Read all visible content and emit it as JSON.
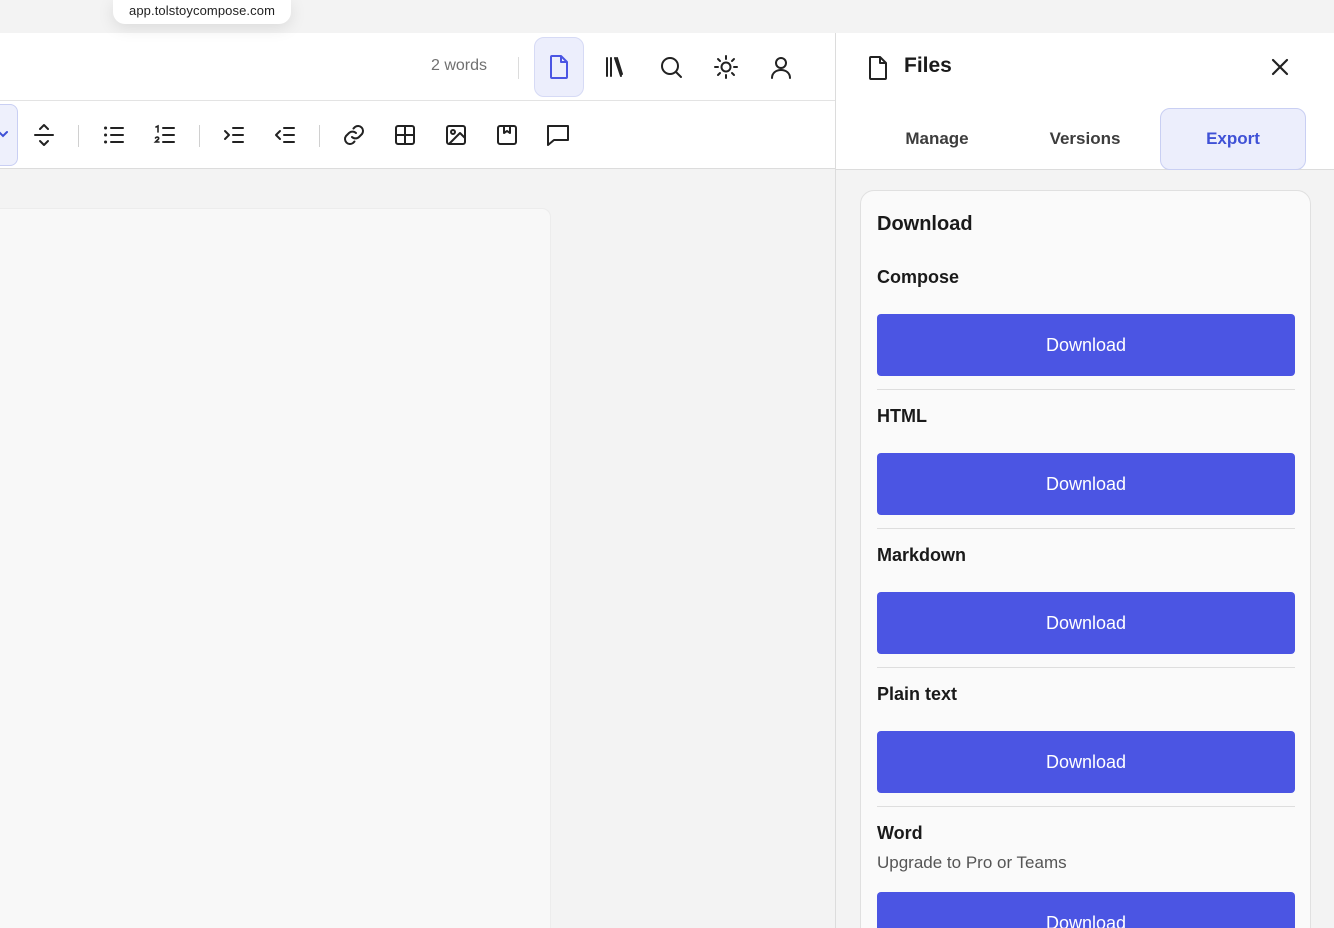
{
  "url_bar": {
    "text": "app.tolstoycompose.com"
  },
  "topbar": {
    "word_count": "2 words",
    "icons": [
      "file-icon",
      "library-icon",
      "search-icon",
      "sun-icon",
      "user-icon"
    ],
    "active_icon": "file-icon"
  },
  "toolbar": {
    "icons": [
      "collapse-icon",
      "bullet-list-icon",
      "numbered-list-icon",
      "indent-icon",
      "outdent-icon",
      "link-icon",
      "table-icon",
      "image-icon",
      "bookmark-icon",
      "comment-icon"
    ]
  },
  "panel": {
    "title": "Files",
    "tabs": [
      {
        "label": "Manage",
        "active": false
      },
      {
        "label": "Versions",
        "active": false
      },
      {
        "label": "Export",
        "active": true
      }
    ],
    "download_title": "Download",
    "sections": [
      {
        "label": "Compose",
        "note": "",
        "button": "Download"
      },
      {
        "label": "HTML",
        "note": "",
        "button": "Download"
      },
      {
        "label": "Markdown",
        "note": "",
        "button": "Download"
      },
      {
        "label": "Plain text",
        "note": "",
        "button": "Download"
      },
      {
        "label": "Word",
        "note": "Upgrade to Pro or Teams",
        "button": "Download"
      }
    ]
  },
  "colors": {
    "accent": "#4b55e3",
    "active_tab_bg": "#eceefc",
    "active_tab_text": "#3f51d6"
  }
}
